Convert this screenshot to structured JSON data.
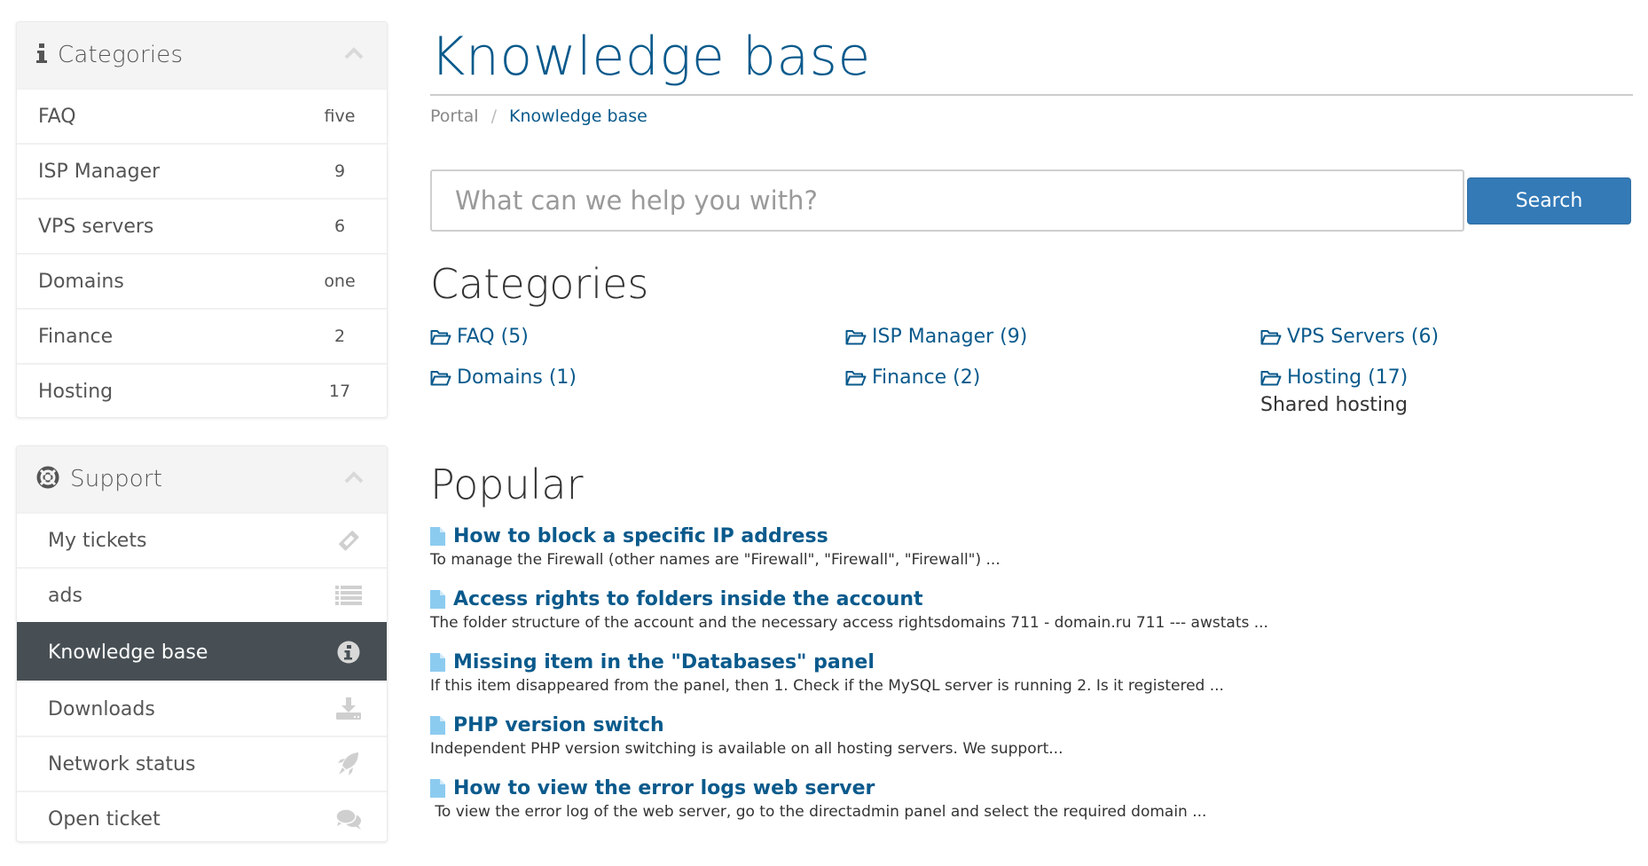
{
  "sidebar": {
    "categories_panel": {
      "title": "Categories",
      "icon": "info-icon",
      "items": [
        {
          "label": "FAQ",
          "count": "five"
        },
        {
          "label": "ISP Manager",
          "count": "9"
        },
        {
          "label": "VPS servers",
          "count": "6"
        },
        {
          "label": "Domains",
          "count": "one"
        },
        {
          "label": "Finance",
          "count": "2"
        },
        {
          "label": "Hosting",
          "count": "17"
        }
      ]
    },
    "support_panel": {
      "title": "Support",
      "icon": "life-ring-icon",
      "items": [
        {
          "label": "My tickets",
          "icon": "ticket-icon",
          "active": false
        },
        {
          "label": "ads",
          "icon": "list-icon",
          "active": false
        },
        {
          "label": "Knowledge base",
          "icon": "info-circle-icon",
          "active": true
        },
        {
          "label": "Downloads",
          "icon": "download-icon",
          "active": false
        },
        {
          "label": "Network status",
          "icon": "rocket-icon",
          "active": false
        },
        {
          "label": "Open ticket",
          "icon": "comments-icon",
          "active": false
        }
      ]
    }
  },
  "main": {
    "title": "Knowledge base",
    "breadcrumb": {
      "items": [
        "Portal",
        "Knowledge base"
      ],
      "separator": "/"
    },
    "search": {
      "placeholder": "What can we help you with?",
      "value": "",
      "button_label": "Search"
    },
    "categories": {
      "heading": "Categories",
      "items": [
        {
          "label": "FAQ (5)",
          "description": ""
        },
        {
          "label": "ISP Manager (9)",
          "description": ""
        },
        {
          "label": "VPS Servers (6)",
          "description": ""
        },
        {
          "label": "Domains (1)",
          "description": ""
        },
        {
          "label": "Finance (2)",
          "description": ""
        },
        {
          "label": "Hosting (17)",
          "description": "Shared hosting"
        }
      ]
    },
    "popular": {
      "heading": "Popular",
      "items": [
        {
          "title": "How to block a specific IP address",
          "excerpt": "To manage the Firewall (other names are \"Firewall\", \"Firewall\", \"Firewall\") ..."
        },
        {
          "title": "Access rights to folders inside the account",
          "excerpt": "The folder structure of the account and the necessary access rightsdomains 711 - domain.ru 711 --- awstats ..."
        },
        {
          "title": "Missing item in the \"Databases\" panel",
          "excerpt": "If this item disappeared from the panel, then 1. Check if the MySQL server is running 2. Is it registered ..."
        },
        {
          "title": "PHP version switch",
          "excerpt": "Independent PHP version switching is available on all hosting servers. We support..."
        },
        {
          "title": "How to view the error logs web server",
          "excerpt": " To view the error log of the web server, go to the directadmin panel and select the required domain ..."
        }
      ]
    }
  },
  "colors": {
    "brand": "#0a5a8c",
    "button": "#337ab7",
    "active_nav": "#474f54",
    "doc_icon": "#8ccbf0"
  }
}
